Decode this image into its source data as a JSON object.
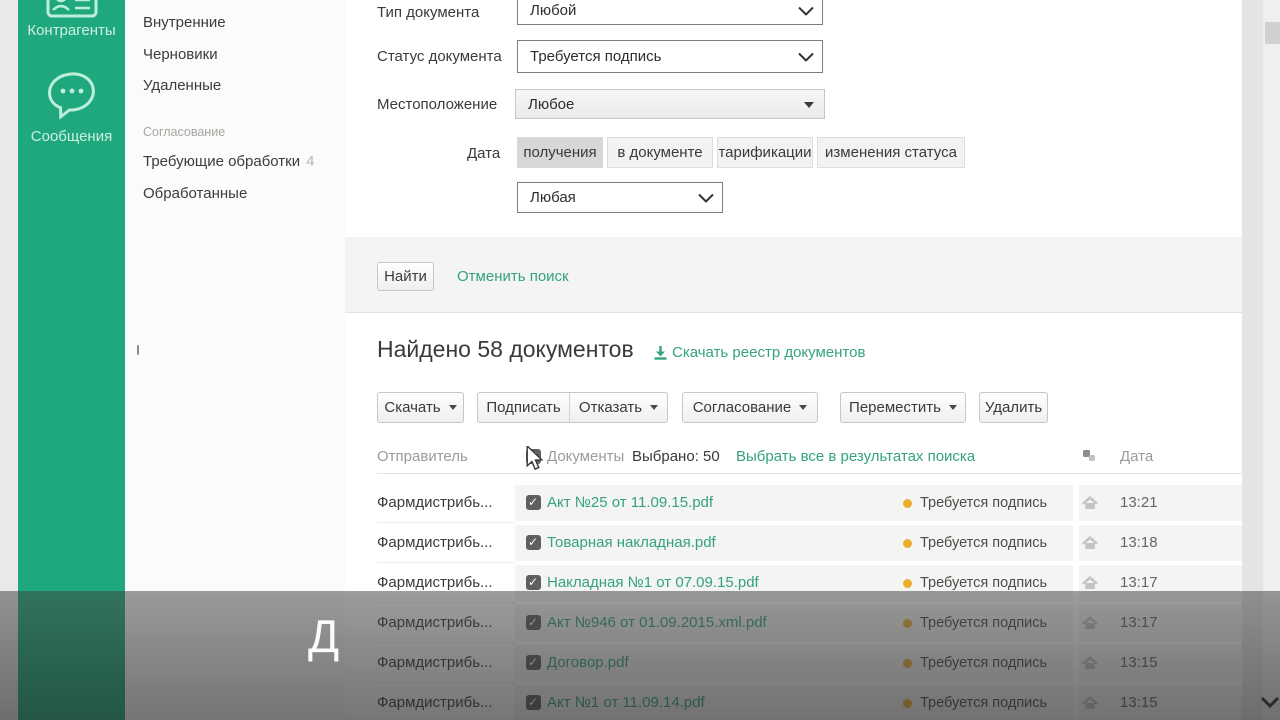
{
  "colors": {
    "brand_green": "#1fa87d",
    "link_teal": "#35a183",
    "status_dot_orange": "#ecae2f",
    "row_background": "#f4f4f2"
  },
  "sidebar": {
    "contacts_label": "Контрагенты",
    "messages_label": "Сообщения"
  },
  "menu": {
    "items": [
      {
        "label": "Внутренние"
      },
      {
        "label": "Черновики"
      },
      {
        "label": "Удаленные"
      }
    ],
    "section_title": "Согласование",
    "section_items": [
      {
        "label": "Требующие обработки",
        "badge": "4"
      },
      {
        "label": "Обработанные",
        "badge": ""
      }
    ]
  },
  "search_form": {
    "type_label": "Тип документа",
    "type_value": "Любой",
    "status_label": "Статус документа",
    "status_value": "Требуется подпись",
    "location_label": "Местоположение",
    "location_value": "Любое",
    "date_label": "Дата",
    "date_tabs": [
      {
        "label": "получения"
      },
      {
        "label": "в документе"
      },
      {
        "label": "тарификации"
      },
      {
        "label": "изменения статуса"
      }
    ],
    "active_date_tab": "получения",
    "period_value": "Любая",
    "find_button": "Найти",
    "cancel_link": "Отменить поиск"
  },
  "results": {
    "title": "Найдено 58 документов",
    "download_registry": "Скачать реестр документов",
    "toolbar": {
      "download": "Скачать",
      "sign": "Подписать",
      "refuse": "Отказать",
      "approval": "Согласование",
      "move": "Переместить",
      "remove": "Удалить"
    },
    "header": {
      "sender": "Отправитель",
      "documents": "Документы",
      "selected": "Выбрано: 50",
      "select_all": "Выбрать все в результатах поиска",
      "date": "Дата"
    },
    "rows": [
      {
        "sender": "Фармдистрибь...",
        "doc": "Акт №25 от 11.09.15.pdf",
        "status": "Требуется подпись",
        "time": "13:21"
      },
      {
        "sender": "Фармдистрибь...",
        "doc": "Товарная накладная.pdf",
        "status": "Требуется подпись",
        "time": "13:18"
      },
      {
        "sender": "Фармдистрибь...",
        "doc": "Накладная №1 от 07.09.15.pdf",
        "status": "Требуется подпись",
        "time": "13:17"
      },
      {
        "sender": "Фармдистрибь...",
        "doc": "Акт №946 от 01.09.2015.xml.pdf",
        "status": "Требуется подпись",
        "time": "13:17"
      },
      {
        "sender": "Фармдистрибь...",
        "doc": "Договор.pdf",
        "status": "Требуется подпись",
        "time": "13:15"
      },
      {
        "sender": "Фармдистрибь...",
        "doc": "Акт №1 от 11.09.14.pdf",
        "status": "Требуется подпись",
        "time": "13:15"
      }
    ]
  },
  "video_overlay": {
    "letter": "Д"
  }
}
